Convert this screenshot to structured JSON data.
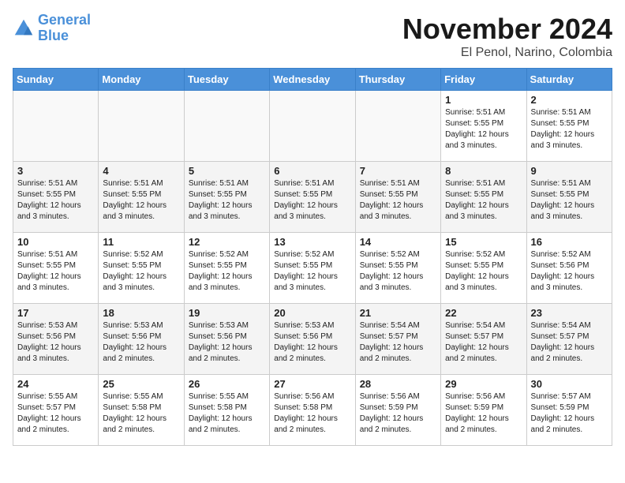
{
  "logo": {
    "line1": "General",
    "line2": "Blue"
  },
  "title": "November 2024",
  "location": "El Penol, Narino, Colombia",
  "weekdays": [
    "Sunday",
    "Monday",
    "Tuesday",
    "Wednesday",
    "Thursday",
    "Friday",
    "Saturday"
  ],
  "weeks": [
    [
      {
        "day": "",
        "info": ""
      },
      {
        "day": "",
        "info": ""
      },
      {
        "day": "",
        "info": ""
      },
      {
        "day": "",
        "info": ""
      },
      {
        "day": "",
        "info": ""
      },
      {
        "day": "1",
        "info": "Sunrise: 5:51 AM\nSunset: 5:55 PM\nDaylight: 12 hours and 3 minutes."
      },
      {
        "day": "2",
        "info": "Sunrise: 5:51 AM\nSunset: 5:55 PM\nDaylight: 12 hours and 3 minutes."
      }
    ],
    [
      {
        "day": "3",
        "info": "Sunrise: 5:51 AM\nSunset: 5:55 PM\nDaylight: 12 hours and 3 minutes."
      },
      {
        "day": "4",
        "info": "Sunrise: 5:51 AM\nSunset: 5:55 PM\nDaylight: 12 hours and 3 minutes."
      },
      {
        "day": "5",
        "info": "Sunrise: 5:51 AM\nSunset: 5:55 PM\nDaylight: 12 hours and 3 minutes."
      },
      {
        "day": "6",
        "info": "Sunrise: 5:51 AM\nSunset: 5:55 PM\nDaylight: 12 hours and 3 minutes."
      },
      {
        "day": "7",
        "info": "Sunrise: 5:51 AM\nSunset: 5:55 PM\nDaylight: 12 hours and 3 minutes."
      },
      {
        "day": "8",
        "info": "Sunrise: 5:51 AM\nSunset: 5:55 PM\nDaylight: 12 hours and 3 minutes."
      },
      {
        "day": "9",
        "info": "Sunrise: 5:51 AM\nSunset: 5:55 PM\nDaylight: 12 hours and 3 minutes."
      }
    ],
    [
      {
        "day": "10",
        "info": "Sunrise: 5:51 AM\nSunset: 5:55 PM\nDaylight: 12 hours and 3 minutes."
      },
      {
        "day": "11",
        "info": "Sunrise: 5:52 AM\nSunset: 5:55 PM\nDaylight: 12 hours and 3 minutes."
      },
      {
        "day": "12",
        "info": "Sunrise: 5:52 AM\nSunset: 5:55 PM\nDaylight: 12 hours and 3 minutes."
      },
      {
        "day": "13",
        "info": "Sunrise: 5:52 AM\nSunset: 5:55 PM\nDaylight: 12 hours and 3 minutes."
      },
      {
        "day": "14",
        "info": "Sunrise: 5:52 AM\nSunset: 5:55 PM\nDaylight: 12 hours and 3 minutes."
      },
      {
        "day": "15",
        "info": "Sunrise: 5:52 AM\nSunset: 5:55 PM\nDaylight: 12 hours and 3 minutes."
      },
      {
        "day": "16",
        "info": "Sunrise: 5:52 AM\nSunset: 5:56 PM\nDaylight: 12 hours and 3 minutes."
      }
    ],
    [
      {
        "day": "17",
        "info": "Sunrise: 5:53 AM\nSunset: 5:56 PM\nDaylight: 12 hours and 3 minutes."
      },
      {
        "day": "18",
        "info": "Sunrise: 5:53 AM\nSunset: 5:56 PM\nDaylight: 12 hours and 2 minutes."
      },
      {
        "day": "19",
        "info": "Sunrise: 5:53 AM\nSunset: 5:56 PM\nDaylight: 12 hours and 2 minutes."
      },
      {
        "day": "20",
        "info": "Sunrise: 5:53 AM\nSunset: 5:56 PM\nDaylight: 12 hours and 2 minutes."
      },
      {
        "day": "21",
        "info": "Sunrise: 5:54 AM\nSunset: 5:57 PM\nDaylight: 12 hours and 2 minutes."
      },
      {
        "day": "22",
        "info": "Sunrise: 5:54 AM\nSunset: 5:57 PM\nDaylight: 12 hours and 2 minutes."
      },
      {
        "day": "23",
        "info": "Sunrise: 5:54 AM\nSunset: 5:57 PM\nDaylight: 12 hours and 2 minutes."
      }
    ],
    [
      {
        "day": "24",
        "info": "Sunrise: 5:55 AM\nSunset: 5:57 PM\nDaylight: 12 hours and 2 minutes."
      },
      {
        "day": "25",
        "info": "Sunrise: 5:55 AM\nSunset: 5:58 PM\nDaylight: 12 hours and 2 minutes."
      },
      {
        "day": "26",
        "info": "Sunrise: 5:55 AM\nSunset: 5:58 PM\nDaylight: 12 hours and 2 minutes."
      },
      {
        "day": "27",
        "info": "Sunrise: 5:56 AM\nSunset: 5:58 PM\nDaylight: 12 hours and 2 minutes."
      },
      {
        "day": "28",
        "info": "Sunrise: 5:56 AM\nSunset: 5:59 PM\nDaylight: 12 hours and 2 minutes."
      },
      {
        "day": "29",
        "info": "Sunrise: 5:56 AM\nSunset: 5:59 PM\nDaylight: 12 hours and 2 minutes."
      },
      {
        "day": "30",
        "info": "Sunrise: 5:57 AM\nSunset: 5:59 PM\nDaylight: 12 hours and 2 minutes."
      }
    ]
  ]
}
